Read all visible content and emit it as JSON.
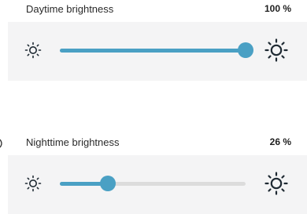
{
  "daytime": {
    "label": "Daytime brightness",
    "value_text": "100 %",
    "level": 1.0
  },
  "nighttime": {
    "label": "Nighttime brightness",
    "value_text": "26 %",
    "level": 0.26
  },
  "colors": {
    "accent": "#4aa0c4",
    "track": "#dcdcdc",
    "panel": "#f4f4f5",
    "icon": "#1f2a33"
  },
  "icons": {
    "dim": "sun-small-icon",
    "bright": "sun-large-icon"
  }
}
